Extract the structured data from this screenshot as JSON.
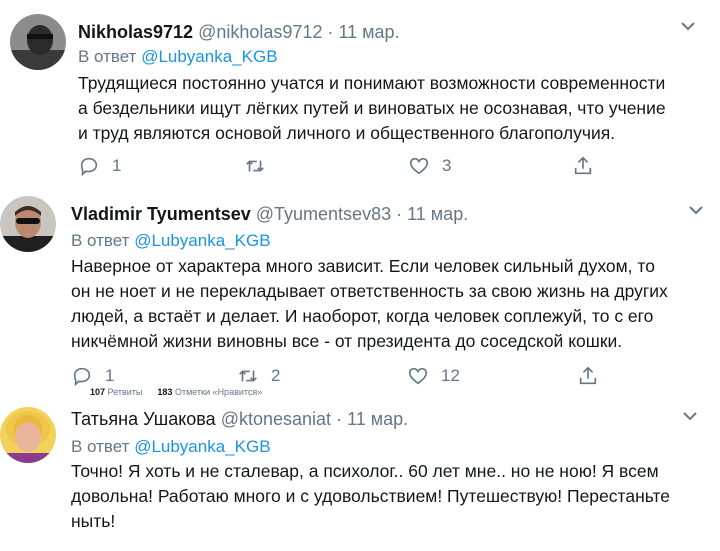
{
  "tweets": [
    {
      "name": "Nikholas9712",
      "handle": "@nikholas9712",
      "date": "11 мар.",
      "reply_prefix": "В ответ",
      "reply_to": "@Lubyanka_KGB",
      "lines": [
        "Трудящиеся постоянно учатся и понимают возможности  современности",
        "а бездельники ищут лёгких путей и виноватых  не осознавая, что учение",
        "и труд являются основой личного и общественного благополучия."
      ],
      "replies": "1",
      "retweets": "",
      "likes": "3"
    },
    {
      "name": "Vladimir Tyumentsev",
      "handle": "@Tyumentsev83",
      "date": "11 мар.",
      "reply_prefix": "В ответ",
      "reply_to": "@Lubyanka_KGB",
      "lines": [
        "Наверное от характера много зависит. Если человек сильный духом, то",
        "он не ноет и не перекладывает ответственность за свою жизнь на других",
        "людей, а встаёт и делает. И наоборот, когда человек соплежуй, то с его",
        "никчёмной жизни виновны все - от президента до соседской кошки."
      ],
      "replies": "1",
      "retweets": "2",
      "likes": "12"
    },
    {
      "name": "Татьяна Ушакова",
      "handle": "@ktonesaniat",
      "date": "11 мар.",
      "reply_prefix": "В ответ",
      "reply_to": "@Lubyanka_KGB",
      "lines": [
        "Точно! Я хоть и не сталевар, а психолог.. 60 лет мне.. но не ною! Я всем",
        "довольна! Работаю много и с удовольствием! Путешествую! Перестаньте",
        "ныть!"
      ]
    }
  ],
  "overlay": {
    "retweets_count": "107",
    "retweets_label": "Ретвиты",
    "likes_count": "183",
    "likes_label": "Отметки «Нравится»"
  },
  "colors": {
    "text": "#14171a",
    "secondary": "#657786",
    "link": "#1b95e0"
  },
  "icons": [
    "reply-icon",
    "retweet-icon",
    "like-icon",
    "share-icon",
    "chevron-down-icon"
  ]
}
